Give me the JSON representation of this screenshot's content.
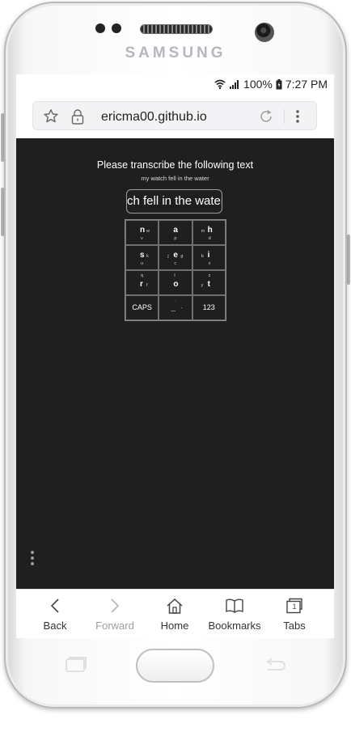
{
  "device": {
    "brand": "SAMSUNG"
  },
  "status_bar": {
    "battery": "100%",
    "time": "7:27 PM"
  },
  "browser": {
    "url": "ericma00.github.io",
    "toolbar": [
      {
        "label": "Back",
        "icon": "chevron-left-icon",
        "enabled": true
      },
      {
        "label": "Forward",
        "icon": "chevron-right-icon",
        "enabled": false
      },
      {
        "label": "Home",
        "icon": "home-icon",
        "enabled": true
      },
      {
        "label": "Bookmarks",
        "icon": "book-icon",
        "enabled": true
      },
      {
        "label": "Tabs",
        "icon": "tabs-icon",
        "enabled": true,
        "count": "1"
      }
    ]
  },
  "page": {
    "prompt": "Please transcribe the following text",
    "target_text": "my watch fell in the water",
    "typed_text": "ch fell in the water",
    "keys": [
      {
        "main": "n",
        "extras": [
          "w",
          "v"
        ]
      },
      {
        "main": "a",
        "extras": [
          "p"
        ]
      },
      {
        "main": "h",
        "extras": [
          "m",
          "d"
        ]
      },
      {
        "main": "s",
        "extras": [
          "k",
          "u"
        ]
      },
      {
        "main": "e",
        "extras": [
          "j",
          "g",
          "c"
        ]
      },
      {
        "main": "i",
        "extras": [
          "b",
          "x"
        ]
      },
      {
        "main": "r",
        "extras": [
          "q",
          "f"
        ]
      },
      {
        "main": "o",
        "extras": [
          "l"
        ]
      },
      {
        "main": "t",
        "extras": [
          "z",
          "y"
        ]
      },
      {
        "label": "CAPS"
      },
      {
        "main": "_",
        "extras": [
          ".",
          "'"
        ]
      },
      {
        "label": "123"
      }
    ]
  }
}
